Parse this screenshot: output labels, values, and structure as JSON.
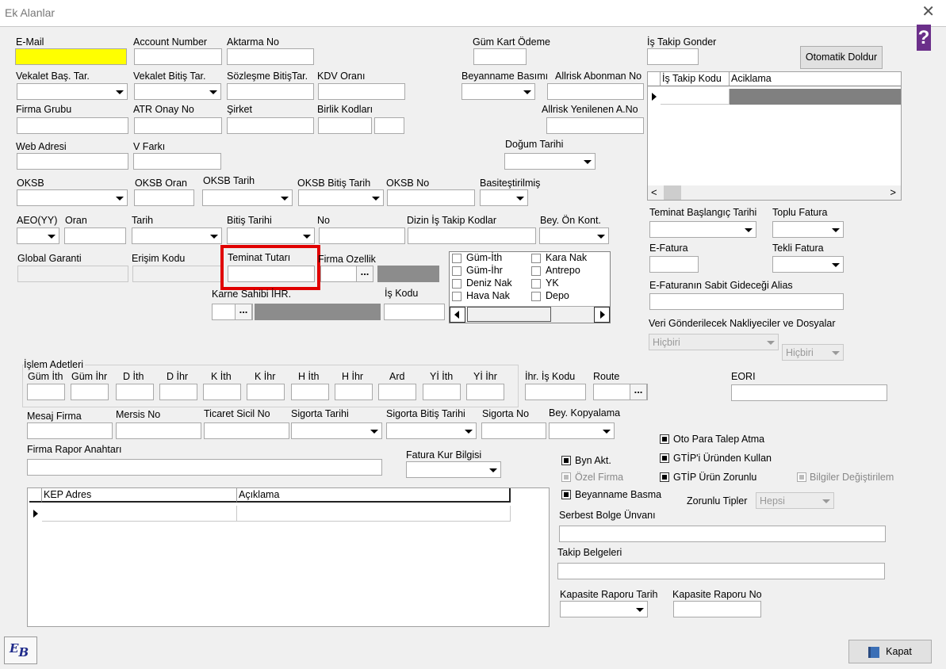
{
  "window": {
    "title": "Ek Alanlar"
  },
  "labels": {
    "email": "E-Mail",
    "account_number": "Account Number",
    "aktarma_no": "Aktarma No",
    "gum_kart_odeme": "Güm Kart Ödeme",
    "is_takip_gonder": "İş Takip Gonder",
    "vekalet_bas": "Vekalet Baş. Tar.",
    "vekalet_bitis": "Vekalet Bitiş Tar.",
    "sozlesme_bitis": "Sözleşme BitişTar.",
    "kdv_orani": "KDV Oranı",
    "beyanname_basimi": "Beyanname Basımı",
    "allrisk_abonman": "Allrisk Abonman No",
    "firma_grubu": "Firma Grubu",
    "atr_onay": "ATR Onay No",
    "sirket": "Şirket",
    "birlik_kodlari": "Birlik Kodları",
    "allrisk_yenilenen": "Allrisk Yenilenen A.No",
    "web_adresi": "Web Adresi",
    "v_farki": "V Farkı",
    "dogum_tarihi": "Doğum Tarihi",
    "oksb": "OKSB",
    "oksb_oran": "OKSB Oran",
    "oksb_tarih": "OKSB Tarih",
    "oksb_bitis": "OKSB Bitiş Tarih",
    "oksb_no": "OKSB No",
    "basitestirilmis": "Basiteştirilmiş",
    "aeo": "AEO(YY)",
    "oran": "Oran",
    "tarih": "Tarih",
    "bitis_tarihi": "Bitiş Tarihi",
    "no": "No",
    "dizin_is_takip": "Dizin İş Takip Kodlar",
    "bey_on_kont": "Bey. Ön Kont.",
    "global_garanti": "Global Garanti",
    "erisim_kodu": "Erişim Kodu",
    "teminat_tutari": "Teminat Tutarı",
    "firma_ozellik": "Firma Ozellik",
    "karne_sahibi": "Karne Sahibi İHR.",
    "is_kodu": "İş Kodu",
    "teminat_baslangic": "Teminat Başlangıç Tarihi",
    "toplu_fatura": "Toplu Fatura",
    "e_fatura": "E-Fatura",
    "tekli_fatura": "Tekli Fatura",
    "e_fatura_alias": "E-Faturanın Sabit Gideceği Alias",
    "veri_gonderilecek": "Veri Gönderilecek Nakliyeciler ve Dosyalar",
    "islem_adetleri": "İşlem Adetleri",
    "ihr_is_kodu": "İhr. İş Kodu",
    "route": "Route",
    "eori": "EORI",
    "mesaj_firma": "Mesaj Firma",
    "mersis_no": "Mersis No",
    "ticaret_sicil": "Ticaret Sicil No",
    "sigorta_tarihi": "Sigorta Tarihi",
    "sigorta_bitis": "Sigorta Bitiş Tarihi",
    "sigorta_no": "Sigorta No",
    "bey_kopyalama": "Bey. Kopyalama",
    "firma_rapor": "Firma Rapor Anahtarı",
    "fatura_kur": "Fatura Kur Bilgisi",
    "zorunlu_tipler": "Zorunlu Tipler",
    "serbest_bolge": "Serbest Bolge Ünvanı",
    "takip_belgeleri": "Takip Belgeleri",
    "kapasite_tarih": "Kapasite Raporu Tarih",
    "kapasite_no": "Kapasite Raporu No"
  },
  "islem_cols": [
    "Güm İth",
    "Güm İhr",
    "D İth",
    "D İhr",
    "K İth",
    "K İhr",
    "H İth",
    "H İhr",
    "Ard",
    "Yİ İth",
    "Yİ İhr"
  ],
  "flags_left": [
    {
      "label": "Güm-İth",
      "checked": false
    },
    {
      "label": "Güm-İhr",
      "checked": false
    },
    {
      "label": "Deniz Nak",
      "checked": false
    },
    {
      "label": "Hava Nak",
      "checked": false
    }
  ],
  "flags_right": [
    {
      "label": "Kara Nak",
      "checked": false
    },
    {
      "label": "Antrepo",
      "checked": false
    },
    {
      "label": "YK",
      "checked": false
    },
    {
      "label": "Depo",
      "checked": false
    }
  ],
  "options": {
    "oto_para": {
      "label": "Oto Para Talep Atma",
      "checked": true
    },
    "gtip_urun": {
      "label": "GTİP'i Üründen Kullan",
      "checked": true
    },
    "gtip_zorunlu": {
      "label": "GTİP Ürün Zorunlu",
      "checked": true
    },
    "bilgiler": {
      "label": "Bilgiler Değiştirilem",
      "checked": true
    },
    "byn_akt": {
      "label": "Byn Akt.",
      "checked": true
    },
    "ozel_firma": {
      "label": "Özel Firma",
      "checked": true
    },
    "beyanname_basma": {
      "label": "Beyanname Basma",
      "checked": true
    }
  },
  "is_takip_grid": {
    "columns": [
      "İş Takip Kodu",
      "Aciklama"
    ]
  },
  "kep_grid": {
    "columns": [
      "KEP Adres",
      "Açıklama"
    ]
  },
  "dropdowns": {
    "veri1": "Hiçbiri",
    "veri2": "Hiçbiri",
    "zorunlu": "Hepsi"
  },
  "buttons": {
    "otomatik": "Otomatik Doldur",
    "kapat": "Kapat",
    "dots": "..."
  },
  "highlight_color": "#e00000",
  "logo_text": "EB"
}
